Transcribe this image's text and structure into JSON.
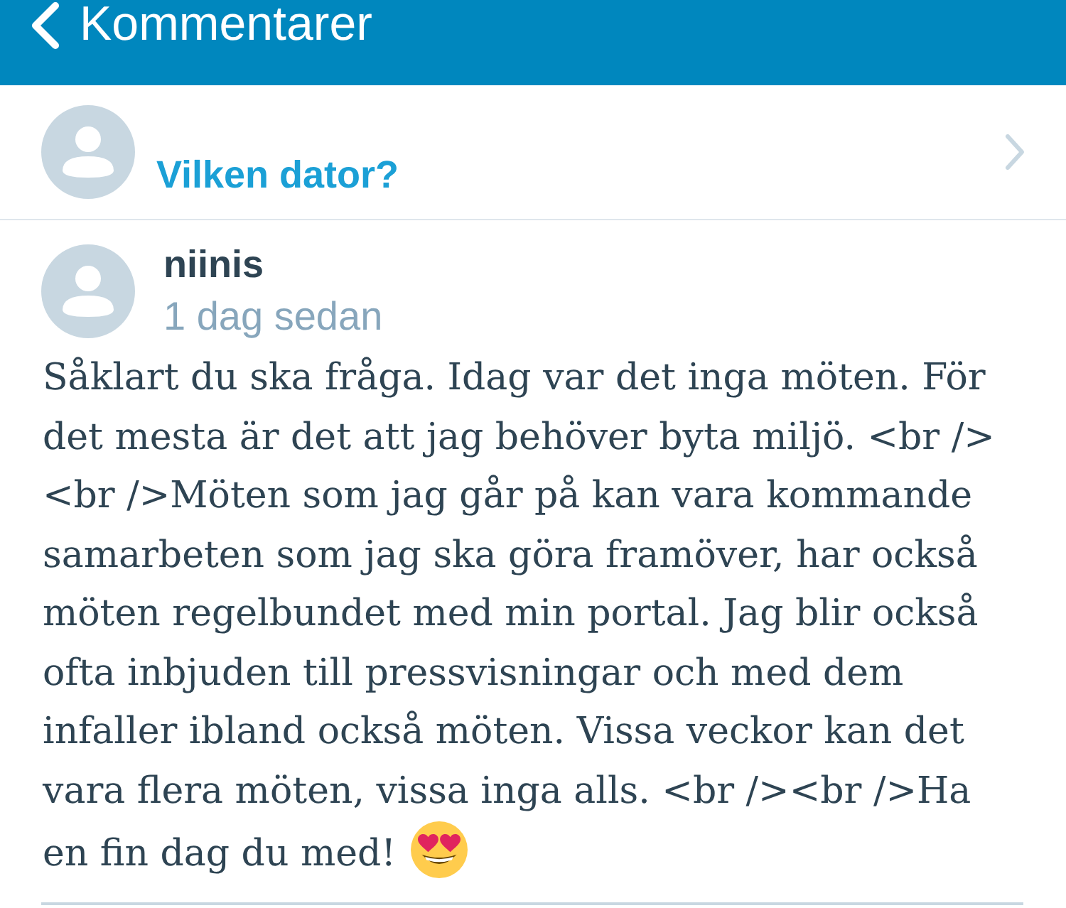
{
  "header": {
    "title": "Kommentarer"
  },
  "post": {
    "title": "Vilken dator?"
  },
  "comments": [
    {
      "author": "niinis",
      "time": "1 dag sedan",
      "text": "Såklart du ska fråga. Idag var det inga möten. För det mesta är det att jag behöver byta miljö. <br /><br />Möten som jag går på kan vara kommande samarbeten som jag ska göra framöver, har också möten regelbundet med min portal. Jag blir också ofta inbjuden till pressvisningar och med dem infaller ibland också möten. Vissa veckor kan det vara flera möten, vissa inga alls. <br /><br />Ha en fin dag du med!"
    }
  ]
}
